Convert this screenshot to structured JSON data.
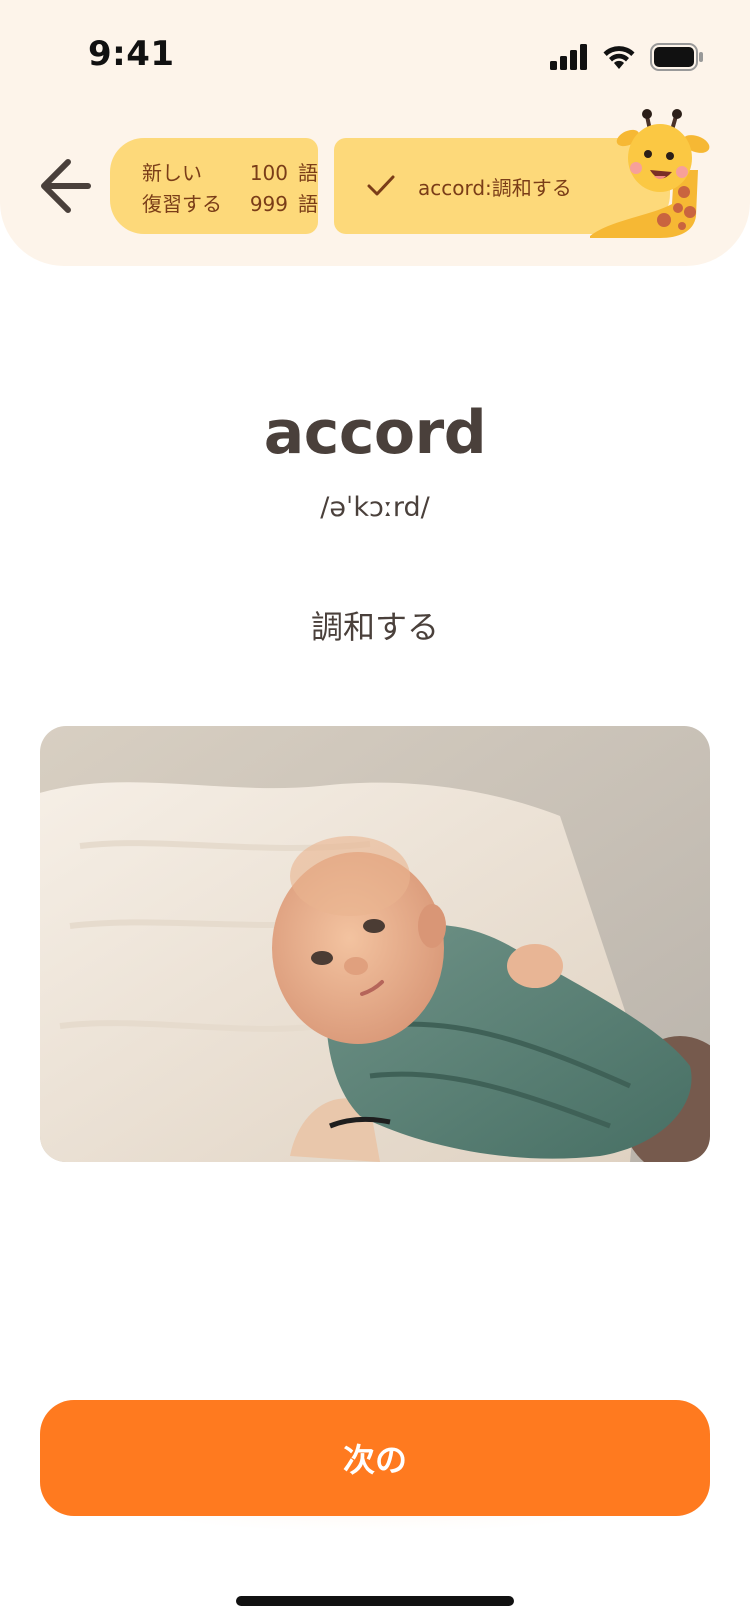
{
  "status_bar": {
    "time": "9:41",
    "icons": [
      "cellular-signal-icon",
      "wifi-icon",
      "battery-icon"
    ]
  },
  "header": {
    "back_icon": "arrow-left-icon",
    "stats": {
      "new_label": "新しい",
      "new_count": "100",
      "review_label": "復習する",
      "review_count": "999",
      "unit": "語"
    },
    "learned_word": {
      "icon": "check-icon",
      "text": "accord:調和する"
    },
    "mascot": "giraffe-mascot"
  },
  "card": {
    "word": "accord",
    "phonetic": "/əˈkɔːrd/",
    "translation": "調和する",
    "image": "baby-photo"
  },
  "next_button": {
    "label": "次の"
  },
  "colors": {
    "header_bg": "#fdf4ea",
    "pill_bg": "#fdd97a",
    "pill_text": "#7a3d18",
    "accent": "#ff7a1f",
    "text": "#4a403b"
  }
}
